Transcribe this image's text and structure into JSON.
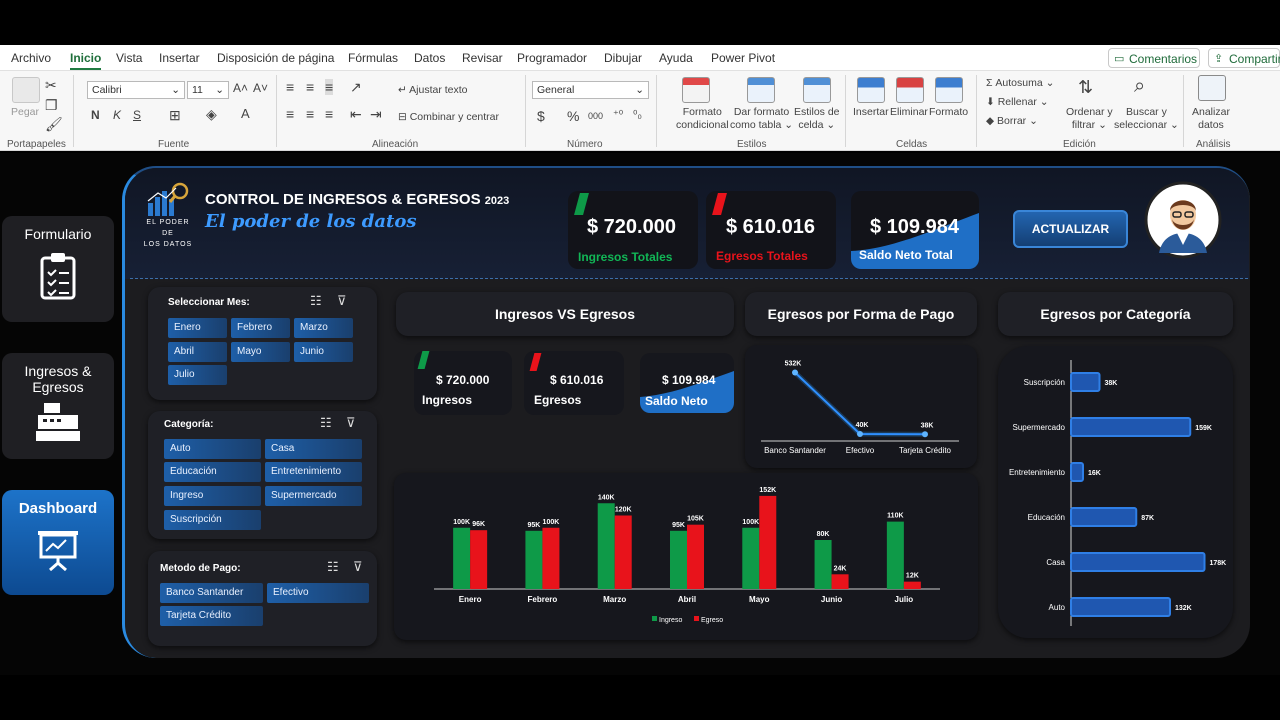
{
  "ribbon": {
    "tabs": [
      "Archivo",
      "Inicio",
      "Vista",
      "Insertar",
      "Disposición de página",
      "Fórmulas",
      "Datos",
      "Revisar",
      "Programador",
      "Dibujar",
      "Ayuda",
      "Power Pivot"
    ],
    "comments_label": "Comentarios",
    "share_label": "Compartir",
    "paste_label": "Pegar",
    "font_name": "Calibri",
    "font_size": "11",
    "wrap_text": "Ajustar texto",
    "merge_center": "Combinar y centrar",
    "number_format": "General",
    "cond_format": [
      "Formato",
      "condicional"
    ],
    "format_table": [
      "Dar formato",
      "como tabla"
    ],
    "cell_styles": [
      "Estilos de",
      "celda"
    ],
    "insert": "Insertar",
    "delete": "Eliminar",
    "format": "Formato",
    "autosum": "Autosuma",
    "fill": "Rellenar",
    "clear": "Borrar",
    "sort_filter": [
      "Ordenar y",
      "filtrar"
    ],
    "find_select": [
      "Buscar y",
      "seleccionar"
    ],
    "analyze": [
      "Analizar",
      "datos"
    ],
    "groups": [
      "Portapapeles",
      "Fuente",
      "Alineación",
      "Número",
      "Estilos",
      "Celdas",
      "Edición",
      "Análisis"
    ]
  },
  "nav": {
    "formulario": "Formulario",
    "ingresos_egresos": [
      "Ingresos &",
      "Egresos"
    ],
    "dashboard": "Dashboard"
  },
  "header": {
    "logo_text": [
      "EL PODER DE",
      "LOS DATOS"
    ],
    "title": "CONTROL DE INGRESOS & EGRESOS",
    "year": "2023",
    "subtitle": "El poder de los datos",
    "update_button": "ACTUALIZAR"
  },
  "kpis": {
    "ingresos_value": "$ 720.000",
    "ingresos_label": "Ingresos Totales",
    "egresos_value": "$ 610.016",
    "egresos_label": "Egresos Totales",
    "saldo_value": "$ 109.984",
    "saldo_label": "Saldo Neto Total"
  },
  "mini_kpis": {
    "ingresos_value": "$ 720.000",
    "ingresos_label": "Ingresos",
    "egresos_value": "$ 610.016",
    "egresos_label": "Egresos",
    "saldo_value": "$ 109.984",
    "saldo_label": "Saldo Neto"
  },
  "slicers": {
    "mes": {
      "title": "Seleccionar Mes:",
      "items": [
        "Enero",
        "Febrero",
        "Marzo",
        "Abril",
        "Mayo",
        "Junio",
        "Julio"
      ]
    },
    "categoria": {
      "title": "Categoría:",
      "items": [
        "Auto",
        "Casa",
        "Educación",
        "Entretenimiento",
        "Ingreso",
        "Supermercado",
        "Suscripción"
      ]
    },
    "pago": {
      "title": "Metodo de Pago:",
      "items": [
        "Banco Santander",
        "Efectivo",
        "Tarjeta Crédito"
      ]
    }
  },
  "chart_titles": {
    "ingresos_vs_egresos": "Ingresos VS Egresos",
    "forma_pago": "Egresos por Forma de Pago",
    "categoria": "Egresos por Categoría"
  },
  "colors": {
    "ingreso": "#0e9a48",
    "egreso": "#e8131b",
    "accent": "#1f6fc6"
  },
  "chart_data": [
    {
      "type": "bar",
      "categories": [
        "Enero",
        "Febrero",
        "Marzo",
        "Abril",
        "Mayo",
        "Junio",
        "Julio"
      ],
      "series": [
        {
          "name": "Ingreso",
          "values": [
            100,
            95,
            140,
            95,
            100,
            80,
            110
          ],
          "labels": [
            "100K",
            "95K",
            "140K",
            "95K",
            "100K",
            "80K",
            "110K"
          ]
        },
        {
          "name": "Egreso",
          "values": [
            96,
            100,
            120,
            105,
            152,
            24,
            12
          ],
          "labels": [
            "96K",
            "100K",
            "120K",
            "105K",
            "152K",
            "24K",
            "12K"
          ]
        }
      ],
      "ylim": [
        0,
        160
      ],
      "legend": "bottom"
    },
    {
      "type": "line",
      "categories": [
        "Banco Santander",
        "Efectivo",
        "Tarjeta Crédito"
      ],
      "values": [
        532,
        40,
        38
      ],
      "labels": [
        "532K",
        "40K",
        "38K"
      ],
      "ylim": [
        0,
        560
      ]
    },
    {
      "type": "bar",
      "orientation": "horizontal",
      "categories": [
        "Suscripción",
        "Supermercado",
        "Entretenimiento",
        "Educación",
        "Casa",
        "Auto"
      ],
      "values": [
        38,
        159,
        16,
        87,
        178,
        132
      ],
      "labels": [
        "38K",
        "159K",
        "16K",
        "87K",
        "178K",
        "132K"
      ],
      "xlim": [
        0,
        180
      ]
    }
  ]
}
